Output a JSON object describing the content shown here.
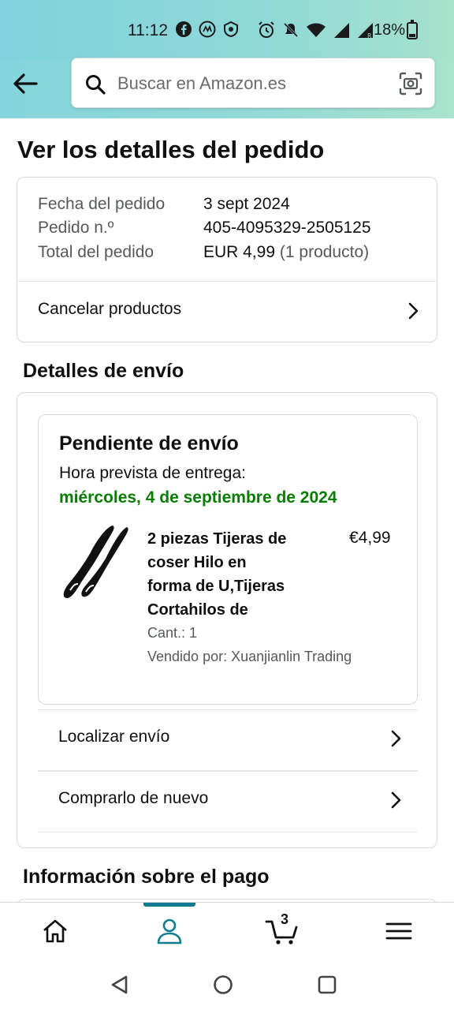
{
  "status_bar": {
    "time": "11:12",
    "battery": "18%",
    "icons": [
      "facebook-icon",
      "coinmarketcap-icon",
      "shield-app-icon",
      "alarm-icon",
      "mute-icon",
      "wifi-icon",
      "signal-icon",
      "signal-roaming-icon",
      "battery-icon"
    ]
  },
  "header": {
    "search_placeholder": "Buscar en Amazon.es"
  },
  "page": {
    "title": "Ver los detalles del pedido"
  },
  "order_summary": {
    "date_label": "Fecha del pedido",
    "date_value": "3 sept 2024",
    "number_label": "Pedido n.º",
    "number_value": "405-4095329-2505125",
    "total_label": "Total del pedido",
    "total_value": "EUR 4,99",
    "total_items": "(1 producto)",
    "cancel_label": "Cancelar productos"
  },
  "shipping": {
    "section_title": "Detalles de envío",
    "status": "Pendiente de envío",
    "delivery_label": "Hora prevista de entrega:",
    "delivery_date": "miércoles, 4 de septiembre de 2024",
    "product": {
      "title_lines": [
        "2 piezas Tijeras de",
        "coser Hilo en",
        "forma de U,Tijeras",
        "Cortahilos de"
      ],
      "price": "€4,99",
      "quantity": "Cant.: 1",
      "seller": "Vendido por: Xuanjianlin Trading"
    },
    "track_label": "Localizar envío",
    "buy_again_label": "Comprarlo de nuevo"
  },
  "payment": {
    "section_title": "Información sobre el pago"
  },
  "bottom_nav": {
    "cart_count": "3",
    "active": "account",
    "accent_color": "#0f7c90"
  },
  "colors": {
    "delivery_green": "#067d00",
    "header_gradient_start": "#7fd3dc",
    "header_gradient_end": "#a6e2cc"
  }
}
